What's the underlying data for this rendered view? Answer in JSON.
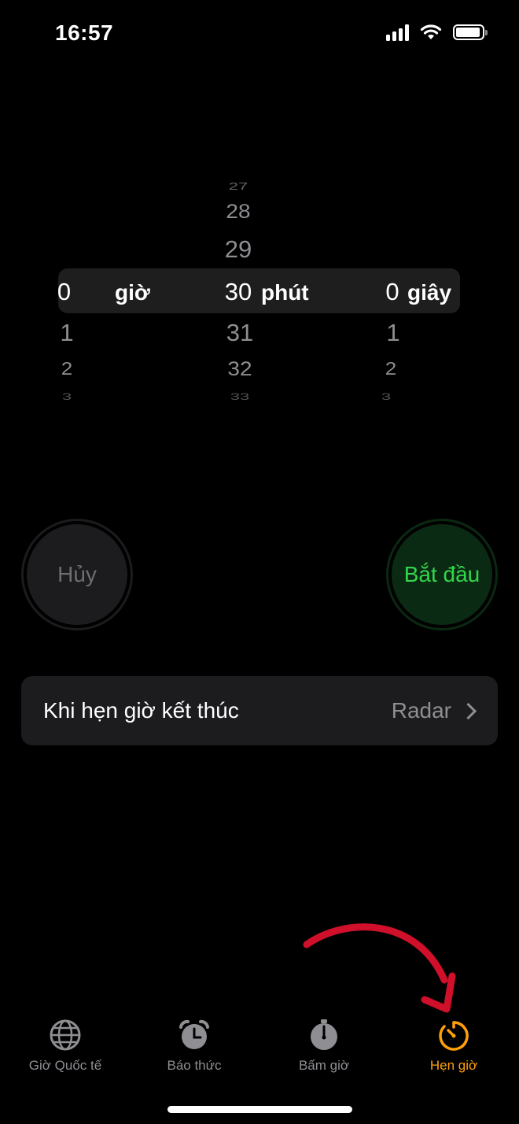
{
  "status": {
    "time": "16:57"
  },
  "picker": {
    "hours": {
      "above": [],
      "selected": "0",
      "below": [
        "1",
        "2",
        "3"
      ],
      "unit": "giờ"
    },
    "minutes": {
      "above": [
        "27",
        "28",
        "29"
      ],
      "selected": "30",
      "below": [
        "31",
        "32",
        "33"
      ],
      "unit": "phút"
    },
    "seconds": {
      "above": [],
      "selected": "0",
      "below": [
        "1",
        "2",
        "3"
      ],
      "unit": "giây"
    }
  },
  "buttons": {
    "cancel": "Hủy",
    "start": "Bắt đầu"
  },
  "when_ends": {
    "label": "Khi hẹn giờ kết thúc",
    "value": "Radar"
  },
  "tabs": [
    {
      "label": "Giờ Quốc tế",
      "icon": "globe-icon"
    },
    {
      "label": "Báo thức",
      "icon": "alarm-clock-icon"
    },
    {
      "label": "Bấm giờ",
      "icon": "stopwatch-icon"
    },
    {
      "label": "Hẹn giờ",
      "icon": "timer-icon",
      "active": true
    }
  ],
  "colors": {
    "accent": "#ff9f0a",
    "start_green": "#32d74b",
    "annotation_arrow": "#d0102a"
  }
}
